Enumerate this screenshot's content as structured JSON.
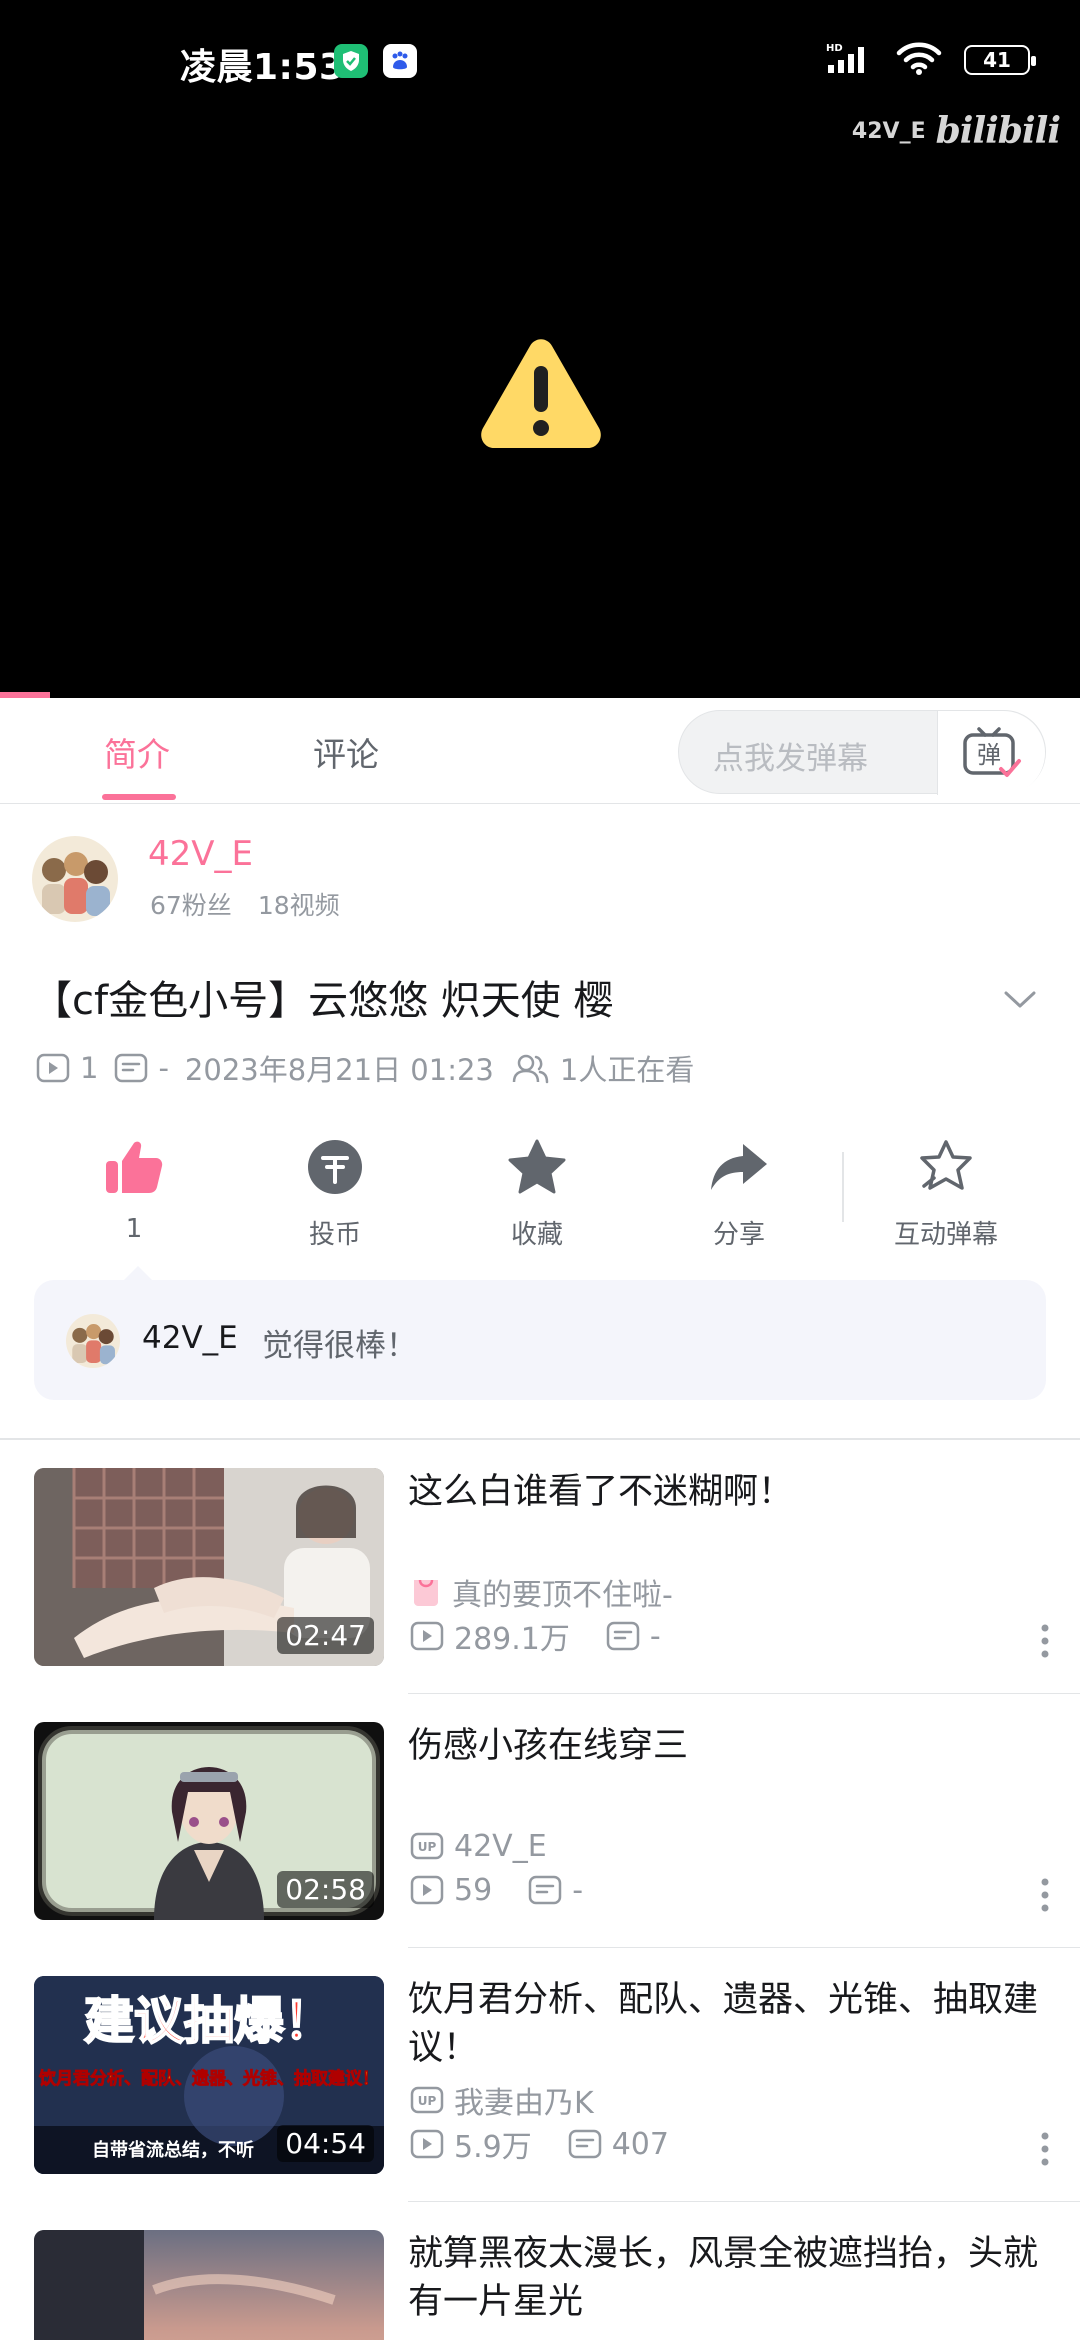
{
  "status_bar": {
    "time": "凌晨1:53",
    "battery": "41",
    "network": "HD"
  },
  "player": {
    "watermark_user": "42V_E",
    "watermark_logo": "bilibili",
    "state_icon": "warning-icon"
  },
  "tabs": [
    {
      "label": "简介",
      "active": true
    },
    {
      "label": "评论",
      "active": false
    }
  ],
  "danmaku": {
    "placeholder": "点我发弹幕",
    "button_glyph": "弹"
  },
  "uploader": {
    "name": "42V_E",
    "fans": "67粉丝",
    "videos": "18视频"
  },
  "video": {
    "title": "【cf金色小号】云悠悠 炽天使 樱",
    "views": "1",
    "danmaku_count": "-",
    "date": "2023年8月21日  01:23",
    "watching": "1人正在看"
  },
  "actions": [
    {
      "icon": "thumbs-up-icon",
      "label": "1"
    },
    {
      "icon": "coin-icon",
      "label": "投币"
    },
    {
      "icon": "star-icon",
      "label": "收藏"
    },
    {
      "icon": "share-icon",
      "label": "分享"
    },
    {
      "icon": "interactive-danmaku-icon",
      "label": "互动弹幕"
    }
  ],
  "recommend": {
    "user": "42V_E",
    "text": "觉得很棒！"
  },
  "related": [
    {
      "title": "这么白谁看了不迷糊啊！",
      "up": "真的要顶不住啦-",
      "up_icon": "bag-icon",
      "views": "289.1万",
      "danmaku": "-",
      "duration": "02:47"
    },
    {
      "title": "伤感小孩在线穿三",
      "up": "42V_E",
      "up_icon": "up-badge-icon",
      "views": "59",
      "danmaku": "-",
      "duration": "02:58"
    },
    {
      "title": "饮月君分析、配队、遗器、光锥、抽取建议！",
      "up": "我妻由乃K",
      "up_icon": "up-badge-icon",
      "views": "5.9万",
      "danmaku": "407",
      "duration": "04:54",
      "thumb_text": "建议抽爆！",
      "thumb_sub": "饮月君分析、配队、遗器、光锥、抽取建议！",
      "thumb_footer": "自带省流总结，不听"
    },
    {
      "title": "就算黑夜太漫长，风景全被遮挡抬，头就有一片星光"
    }
  ],
  "colors": {
    "accent": "#fb7299",
    "text_secondary": "#9499a0",
    "divider": "#e3e5e7",
    "warning": "#ffd966"
  }
}
